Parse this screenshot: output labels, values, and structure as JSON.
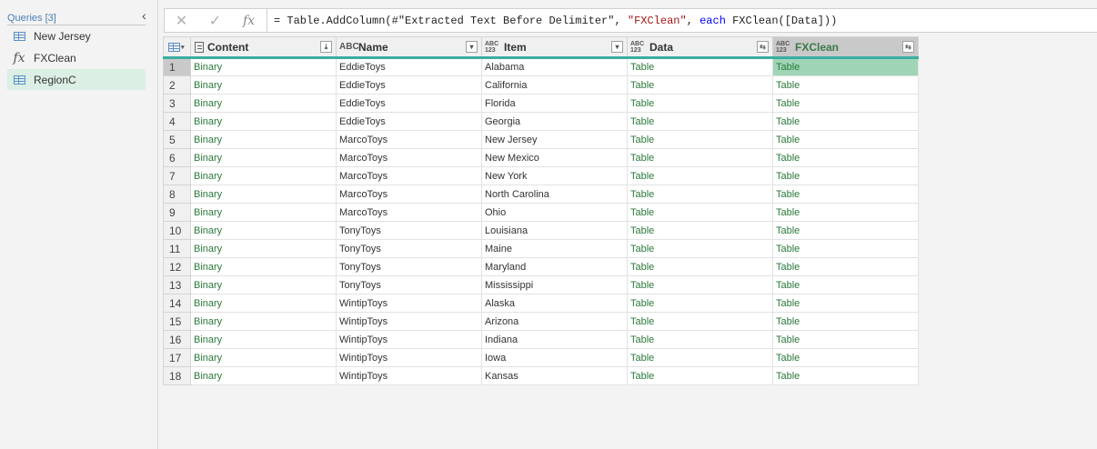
{
  "queries": {
    "header": "Queries [3]",
    "items": [
      {
        "label": "New Jersey",
        "icon": "table-icon"
      },
      {
        "label": "FXClean",
        "icon": "function-icon"
      },
      {
        "label": "RegionC",
        "icon": "table-icon",
        "selected": true
      }
    ]
  },
  "formula_bar": {
    "cancel_icon": "✕",
    "confirm_icon": "✓",
    "fx_icon": "fx",
    "formula": {
      "p1": "= Table.AddColumn(#\"Extracted Text Before Delimiter\", ",
      "p2": "\"FXClean\"",
      "p3": ", ",
      "p4": "each",
      "p5": " FXClean([Data]))"
    }
  },
  "grid": {
    "columns": [
      {
        "name": "Content",
        "type": "binary-icon",
        "button": "⤓"
      },
      {
        "name": "Name",
        "type": "ABC",
        "button": "▾"
      },
      {
        "name": "Item",
        "type": "ABC123",
        "button": "▾"
      },
      {
        "name": "Data",
        "type": "ABC123",
        "button": "⇆"
      },
      {
        "name": "FXClean",
        "type": "ABC123",
        "button": "⇆",
        "selected": true
      }
    ],
    "rows": [
      {
        "n": "1",
        "content": "Binary",
        "name": "EddieToys",
        "item": "Alabama",
        "data": "Table",
        "fx": "Table"
      },
      {
        "n": "2",
        "content": "Binary",
        "name": "EddieToys",
        "item": "California",
        "data": "Table",
        "fx": "Table"
      },
      {
        "n": "3",
        "content": "Binary",
        "name": "EddieToys",
        "item": "Florida",
        "data": "Table",
        "fx": "Table"
      },
      {
        "n": "4",
        "content": "Binary",
        "name": "EddieToys",
        "item": "Georgia",
        "data": "Table",
        "fx": "Table"
      },
      {
        "n": "5",
        "content": "Binary",
        "name": "MarcoToys",
        "item": "New Jersey",
        "data": "Table",
        "fx": "Table"
      },
      {
        "n": "6",
        "content": "Binary",
        "name": "MarcoToys",
        "item": "New Mexico",
        "data": "Table",
        "fx": "Table"
      },
      {
        "n": "7",
        "content": "Binary",
        "name": "MarcoToys",
        "item": "New York",
        "data": "Table",
        "fx": "Table"
      },
      {
        "n": "8",
        "content": "Binary",
        "name": "MarcoToys",
        "item": "North Carolina",
        "data": "Table",
        "fx": "Table"
      },
      {
        "n": "9",
        "content": "Binary",
        "name": "MarcoToys",
        "item": "Ohio",
        "data": "Table",
        "fx": "Table"
      },
      {
        "n": "10",
        "content": "Binary",
        "name": "TonyToys",
        "item": "Louisiana",
        "data": "Table",
        "fx": "Table"
      },
      {
        "n": "11",
        "content": "Binary",
        "name": "TonyToys",
        "item": "Maine",
        "data": "Table",
        "fx": "Table"
      },
      {
        "n": "12",
        "content": "Binary",
        "name": "TonyToys",
        "item": "Maryland",
        "data": "Table",
        "fx": "Table"
      },
      {
        "n": "13",
        "content": "Binary",
        "name": "TonyToys",
        "item": "Mississippi",
        "data": "Table",
        "fx": "Table"
      },
      {
        "n": "14",
        "content": "Binary",
        "name": "WintipToys",
        "item": "Alaska",
        "data": "Table",
        "fx": "Table"
      },
      {
        "n": "15",
        "content": "Binary",
        "name": "WintipToys",
        "item": "Arizona",
        "data": "Table",
        "fx": "Table"
      },
      {
        "n": "16",
        "content": "Binary",
        "name": "WintipToys",
        "item": "Indiana",
        "data": "Table",
        "fx": "Table"
      },
      {
        "n": "17",
        "content": "Binary",
        "name": "WintipToys",
        "item": "Iowa",
        "data": "Table",
        "fx": "Table"
      },
      {
        "n": "18",
        "content": "Binary",
        "name": "WintipToys",
        "item": "Kansas",
        "data": "Table",
        "fx": "Table"
      }
    ]
  },
  "colors": {
    "link_green": "#2b7a3b",
    "header_accent": "#3aada2",
    "selected_cell": "#9fd5b6",
    "selected_query": "#dcefe4"
  }
}
